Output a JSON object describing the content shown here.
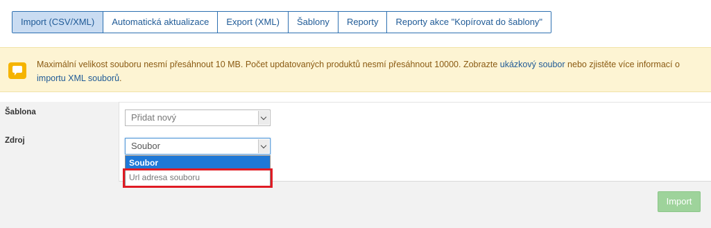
{
  "tabs": [
    {
      "label": "Import (CSV/XML)",
      "active": true
    },
    {
      "label": "Automatická aktualizace",
      "active": false
    },
    {
      "label": "Export (XML)",
      "active": false
    },
    {
      "label": "Šablony",
      "active": false
    },
    {
      "label": "Reporty",
      "active": false
    },
    {
      "label": "Reporty akce \"Kopírovat do šablony\"",
      "active": false
    }
  ],
  "notice": {
    "icon": "message-icon",
    "text_part1": "Maximální velikost souboru nesmí přesáhnout 10 MB. Počet updatovaných produktů nesmí přesáhnout 10000. Zobrazte ",
    "link1": "ukázkový soubor",
    "text_part2": " nebo zjistěte více informací o ",
    "link2": "importu XML souborů",
    "text_part3": "."
  },
  "form": {
    "template_label": "Šablona",
    "template_value": "Přidat nový",
    "source_label": "Zdroj",
    "source_value": "Soubor",
    "source_options": [
      "Soubor",
      "Url adresa souboru"
    ]
  },
  "footer": {
    "import_label": "Import"
  },
  "colors": {
    "tab_active_bg": "#c9dcf2",
    "tab_border": "#2c6fb0",
    "notice_bg": "#fdf4d3",
    "selected_option": "#1e78d7",
    "highlight_border": "#e01b24",
    "import_button": "#9ed39b"
  }
}
